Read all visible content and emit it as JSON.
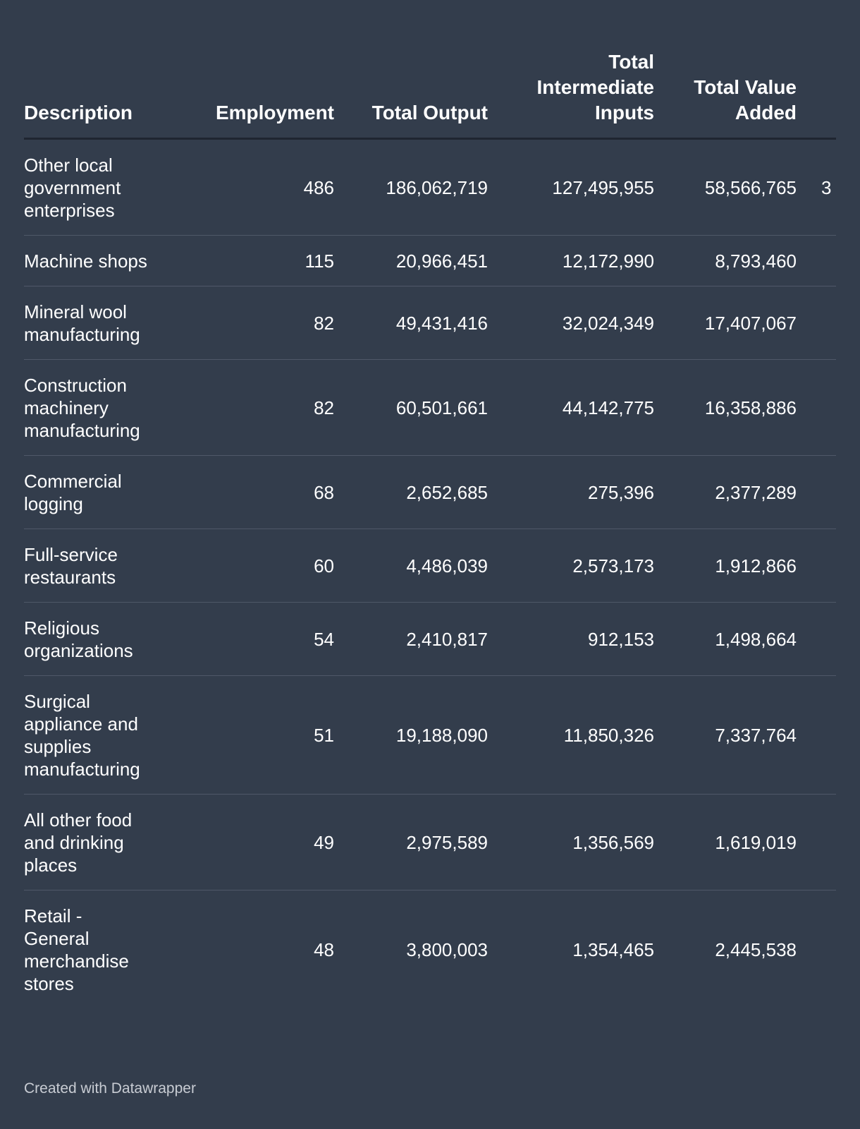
{
  "chart_data": {
    "type": "table",
    "columns": [
      "Description",
      "Employment",
      "Total Output",
      "Total Intermediate Inputs",
      "Total Value Added",
      ""
    ],
    "rows": [
      [
        "Other local government enterprises",
        "486",
        "186,062,719",
        "127,495,955",
        "58,566,765",
        "3"
      ],
      [
        "Machine shops",
        "115",
        "20,966,451",
        "12,172,990",
        "8,793,460",
        ""
      ],
      [
        "Mineral wool manufacturing",
        "82",
        "49,431,416",
        "32,024,349",
        "17,407,067",
        ""
      ],
      [
        "Construction machinery manufacturing",
        "82",
        "60,501,661",
        "44,142,775",
        "16,358,886",
        ""
      ],
      [
        "Commercial logging",
        "68",
        "2,652,685",
        "275,396",
        "2,377,289",
        ""
      ],
      [
        "Full-service restaurants",
        "60",
        "4,486,039",
        "2,573,173",
        "1,912,866",
        ""
      ],
      [
        "Religious organizations",
        "54",
        "2,410,817",
        "912,153",
        "1,498,664",
        ""
      ],
      [
        "Surgical appliance and supplies manufacturing",
        "51",
        "19,188,090",
        "11,850,326",
        "7,337,764",
        ""
      ],
      [
        "All other food and drinking places",
        "49",
        "2,975,589",
        "1,356,569",
        "1,619,019",
        ""
      ],
      [
        "Retail - General merchandise stores",
        "48",
        "3,800,003",
        "1,354,465",
        "2,445,538",
        ""
      ]
    ]
  },
  "footer": {
    "credit": "Created with Datawrapper"
  },
  "colors": {
    "background": "#333d4c",
    "text": "#ffffff",
    "header_rule": "#1f2530",
    "row_rule": "#4f5868"
  }
}
